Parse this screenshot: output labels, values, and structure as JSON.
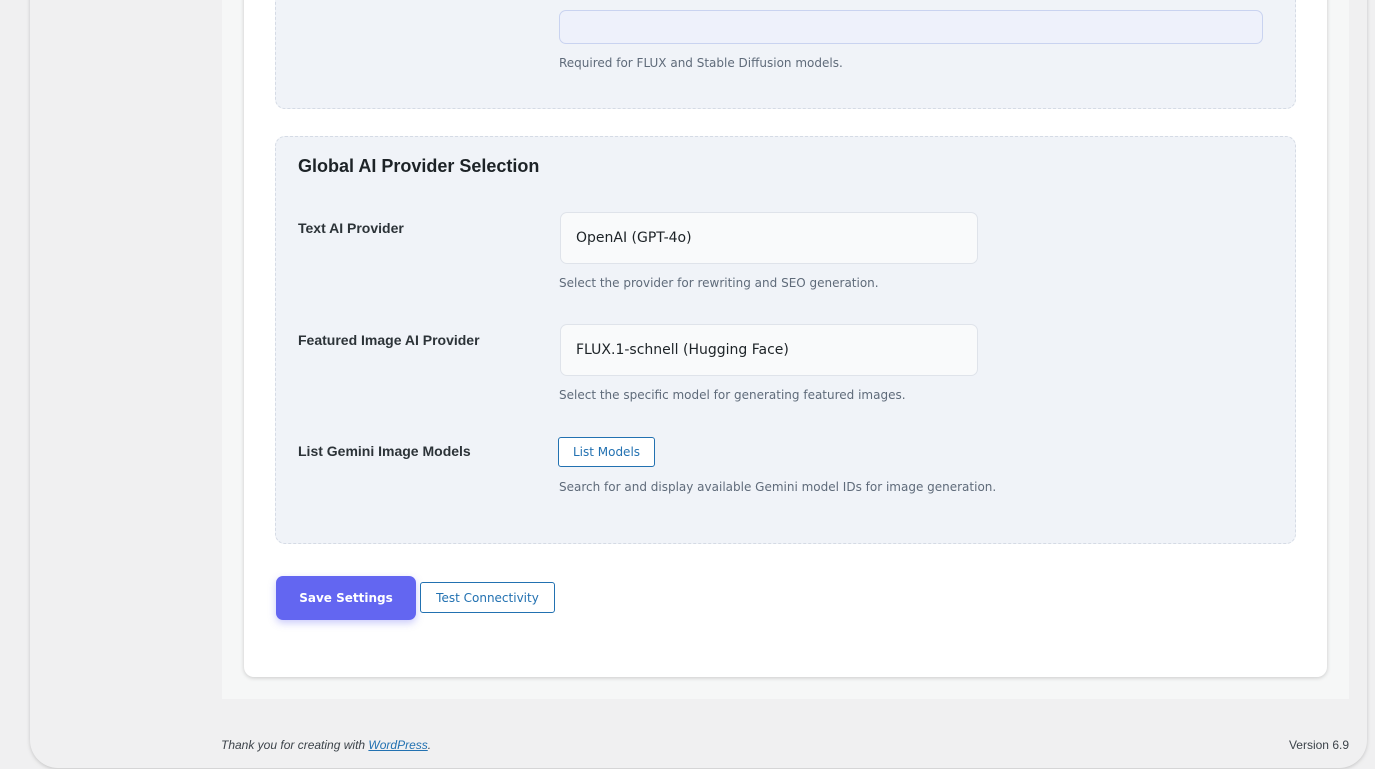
{
  "api_key_section": {
    "input_value": "",
    "input_placeholder": "",
    "help_text": "Required for FLUX and Stable Diffusion models."
  },
  "provider_section": {
    "title": "Global AI Provider Selection",
    "text_provider": {
      "label": "Text AI Provider",
      "selected": "OpenAI (GPT-4o)",
      "help": "Select the provider for rewriting and SEO generation."
    },
    "image_provider": {
      "label": "Featured Image AI Provider",
      "selected": "FLUX.1-schnell (Hugging Face)",
      "help": "Select the specific model for generating featured images."
    },
    "gemini_models": {
      "label": "List Gemini Image Models",
      "button_label": "List Models",
      "help": "Search for and display available Gemini model IDs for image generation."
    }
  },
  "actions": {
    "save_label": "Save Settings",
    "test_label": "Test Connectivity"
  },
  "footer": {
    "thanks_prefix": "Thank you for creating with ",
    "link_text": "WordPress",
    "thanks_suffix": ".",
    "version": "Version 6.9"
  },
  "colors": {
    "primary_button": "#6366f1",
    "link_blue": "#2271b1",
    "section_bg": "#f0f3f8"
  }
}
